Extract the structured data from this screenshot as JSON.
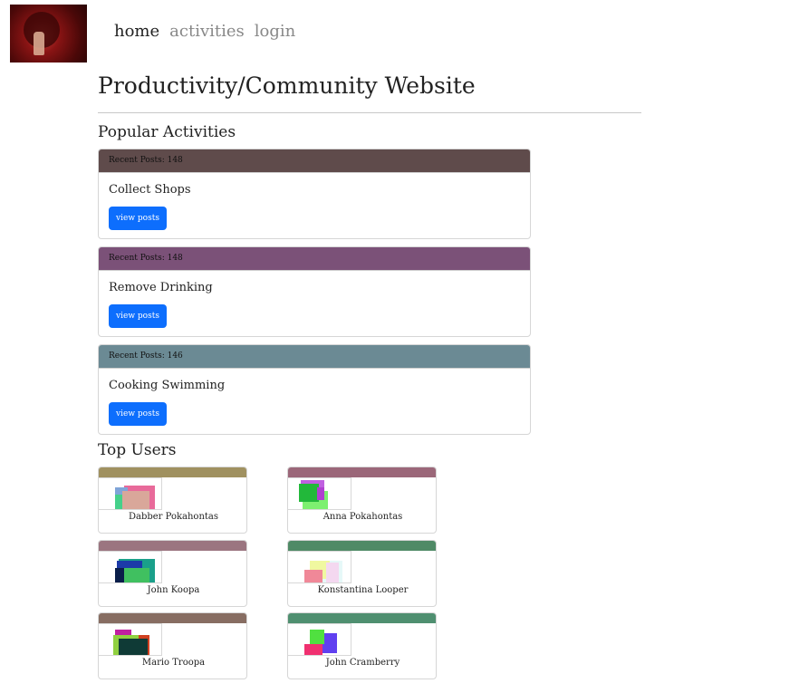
{
  "nav": {
    "home": "home",
    "activities": "activities",
    "login": "login"
  },
  "page_title": "Productivity/Community Website",
  "popular": {
    "heading": "Popular Activities",
    "button_label": "view posts",
    "items": [
      {
        "header": "Recent Posts: 148",
        "title": "Collect Shops",
        "color": "#5f4b4b"
      },
      {
        "header": "Recent Posts: 148",
        "title": "Remove Drinking",
        "color": "#7b5178"
      },
      {
        "header": "Recent Posts: 146",
        "title": "Cooking Swimming",
        "color": "#6b8a94"
      }
    ]
  },
  "top_users": {
    "heading": "Top Users",
    "users": [
      {
        "name": "Dabber Pokahontas",
        "color": "#a09160"
      },
      {
        "name": "Anna Pokahontas",
        "color": "#9b6779"
      },
      {
        "name": "John Koopa",
        "color": "#9b7580"
      },
      {
        "name": "Konstantina Looper",
        "color": "#4f8a66"
      },
      {
        "name": "Mario Troopa",
        "color": "#876d62"
      },
      {
        "name": "John Cramberry",
        "color": "#4f8f70"
      }
    ]
  }
}
